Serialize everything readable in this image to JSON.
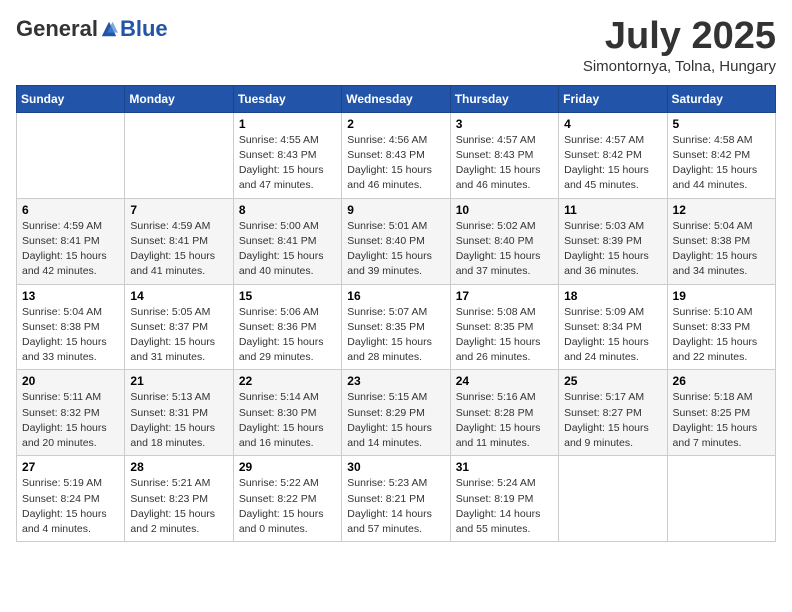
{
  "header": {
    "logo_general": "General",
    "logo_blue": "Blue",
    "month_title": "July 2025",
    "location": "Simontornya, Tolna, Hungary"
  },
  "days_of_week": [
    "Sunday",
    "Monday",
    "Tuesday",
    "Wednesday",
    "Thursday",
    "Friday",
    "Saturday"
  ],
  "weeks": [
    [
      {
        "day": "",
        "info": ""
      },
      {
        "day": "",
        "info": ""
      },
      {
        "day": "1",
        "info": "Sunrise: 4:55 AM\nSunset: 8:43 PM\nDaylight: 15 hours\nand 47 minutes."
      },
      {
        "day": "2",
        "info": "Sunrise: 4:56 AM\nSunset: 8:43 PM\nDaylight: 15 hours\nand 46 minutes."
      },
      {
        "day": "3",
        "info": "Sunrise: 4:57 AM\nSunset: 8:43 PM\nDaylight: 15 hours\nand 46 minutes."
      },
      {
        "day": "4",
        "info": "Sunrise: 4:57 AM\nSunset: 8:42 PM\nDaylight: 15 hours\nand 45 minutes."
      },
      {
        "day": "5",
        "info": "Sunrise: 4:58 AM\nSunset: 8:42 PM\nDaylight: 15 hours\nand 44 minutes."
      }
    ],
    [
      {
        "day": "6",
        "info": "Sunrise: 4:59 AM\nSunset: 8:41 PM\nDaylight: 15 hours\nand 42 minutes."
      },
      {
        "day": "7",
        "info": "Sunrise: 4:59 AM\nSunset: 8:41 PM\nDaylight: 15 hours\nand 41 minutes."
      },
      {
        "day": "8",
        "info": "Sunrise: 5:00 AM\nSunset: 8:41 PM\nDaylight: 15 hours\nand 40 minutes."
      },
      {
        "day": "9",
        "info": "Sunrise: 5:01 AM\nSunset: 8:40 PM\nDaylight: 15 hours\nand 39 minutes."
      },
      {
        "day": "10",
        "info": "Sunrise: 5:02 AM\nSunset: 8:40 PM\nDaylight: 15 hours\nand 37 minutes."
      },
      {
        "day": "11",
        "info": "Sunrise: 5:03 AM\nSunset: 8:39 PM\nDaylight: 15 hours\nand 36 minutes."
      },
      {
        "day": "12",
        "info": "Sunrise: 5:04 AM\nSunset: 8:38 PM\nDaylight: 15 hours\nand 34 minutes."
      }
    ],
    [
      {
        "day": "13",
        "info": "Sunrise: 5:04 AM\nSunset: 8:38 PM\nDaylight: 15 hours\nand 33 minutes."
      },
      {
        "day": "14",
        "info": "Sunrise: 5:05 AM\nSunset: 8:37 PM\nDaylight: 15 hours\nand 31 minutes."
      },
      {
        "day": "15",
        "info": "Sunrise: 5:06 AM\nSunset: 8:36 PM\nDaylight: 15 hours\nand 29 minutes."
      },
      {
        "day": "16",
        "info": "Sunrise: 5:07 AM\nSunset: 8:35 PM\nDaylight: 15 hours\nand 28 minutes."
      },
      {
        "day": "17",
        "info": "Sunrise: 5:08 AM\nSunset: 8:35 PM\nDaylight: 15 hours\nand 26 minutes."
      },
      {
        "day": "18",
        "info": "Sunrise: 5:09 AM\nSunset: 8:34 PM\nDaylight: 15 hours\nand 24 minutes."
      },
      {
        "day": "19",
        "info": "Sunrise: 5:10 AM\nSunset: 8:33 PM\nDaylight: 15 hours\nand 22 minutes."
      }
    ],
    [
      {
        "day": "20",
        "info": "Sunrise: 5:11 AM\nSunset: 8:32 PM\nDaylight: 15 hours\nand 20 minutes."
      },
      {
        "day": "21",
        "info": "Sunrise: 5:13 AM\nSunset: 8:31 PM\nDaylight: 15 hours\nand 18 minutes."
      },
      {
        "day": "22",
        "info": "Sunrise: 5:14 AM\nSunset: 8:30 PM\nDaylight: 15 hours\nand 16 minutes."
      },
      {
        "day": "23",
        "info": "Sunrise: 5:15 AM\nSunset: 8:29 PM\nDaylight: 15 hours\nand 14 minutes."
      },
      {
        "day": "24",
        "info": "Sunrise: 5:16 AM\nSunset: 8:28 PM\nDaylight: 15 hours\nand 11 minutes."
      },
      {
        "day": "25",
        "info": "Sunrise: 5:17 AM\nSunset: 8:27 PM\nDaylight: 15 hours\nand 9 minutes."
      },
      {
        "day": "26",
        "info": "Sunrise: 5:18 AM\nSunset: 8:25 PM\nDaylight: 15 hours\nand 7 minutes."
      }
    ],
    [
      {
        "day": "27",
        "info": "Sunrise: 5:19 AM\nSunset: 8:24 PM\nDaylight: 15 hours\nand 4 minutes."
      },
      {
        "day": "28",
        "info": "Sunrise: 5:21 AM\nSunset: 8:23 PM\nDaylight: 15 hours\nand 2 minutes."
      },
      {
        "day": "29",
        "info": "Sunrise: 5:22 AM\nSunset: 8:22 PM\nDaylight: 15 hours\nand 0 minutes."
      },
      {
        "day": "30",
        "info": "Sunrise: 5:23 AM\nSunset: 8:21 PM\nDaylight: 14 hours\nand 57 minutes."
      },
      {
        "day": "31",
        "info": "Sunrise: 5:24 AM\nSunset: 8:19 PM\nDaylight: 14 hours\nand 55 minutes."
      },
      {
        "day": "",
        "info": ""
      },
      {
        "day": "",
        "info": ""
      }
    ]
  ]
}
